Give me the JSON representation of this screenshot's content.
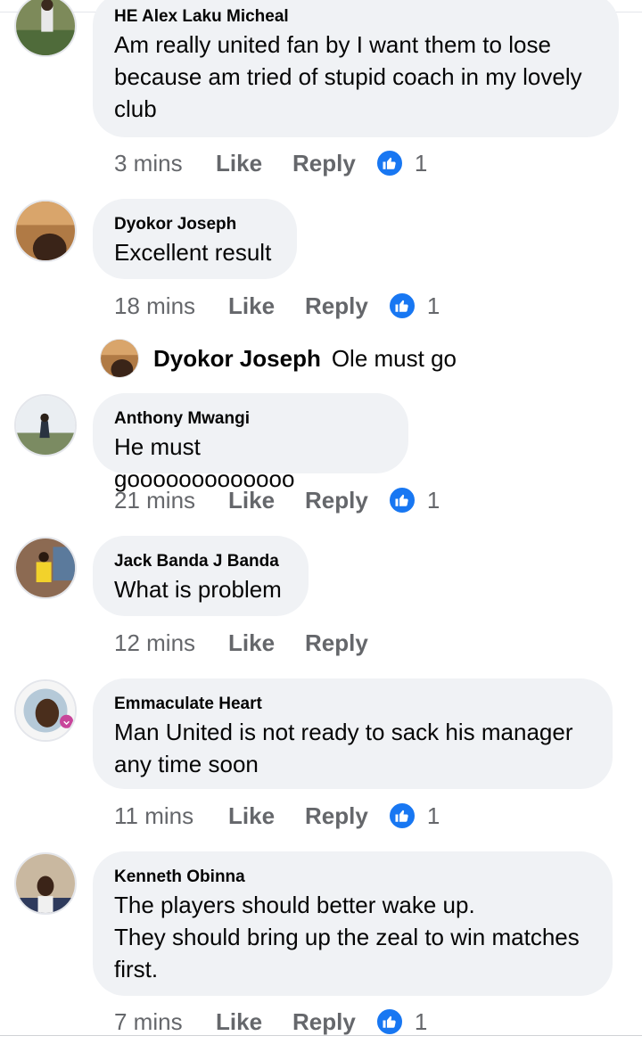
{
  "comments": [
    {
      "author": "HE Alex Laku Micheal",
      "text": "Am really united fan by I want them to lose\nbecause am tried of stupid coach in my lovely\nclub",
      "time": "3 mins",
      "like_label": "Like",
      "reply_label": "Reply",
      "reactions": "1"
    },
    {
      "author": "Dyokor Joseph",
      "text": "Excellent result",
      "time": "18 mins",
      "like_label": "Like",
      "reply_label": "Reply",
      "reactions": "1"
    },
    {
      "author": "Anthony Mwangi",
      "text": "He must gooooooooooooo",
      "time": "21 mins",
      "like_label": "Like",
      "reply_label": "Reply",
      "reactions": "1"
    },
    {
      "author": "Jack Banda J Banda",
      "text": "What is problem",
      "time": "12 mins",
      "like_label": "Like",
      "reply_label": "Reply",
      "reactions": ""
    },
    {
      "author": "Emmaculate Heart",
      "text": " Man United is not ready to sack his manager\nany time soon",
      "time": "11 mins",
      "like_label": "Like",
      "reply_label": "Reply",
      "reactions": "1"
    },
    {
      "author": "Kenneth Obinna",
      "text": "The players should better wake up.\nThey should bring up the zeal to win matches\nfirst.",
      "time": "7 mins",
      "like_label": "Like",
      "reply_label": "Reply",
      "reactions": "1"
    }
  ],
  "reply_preview": {
    "author": "Dyokor Joseph",
    "text": "Ole must go"
  },
  "colors": {
    "bubble": "#f0f2f5",
    "meta_text": "#65676b",
    "like_blue": "#1877f2"
  },
  "icons": {
    "reaction": "thumbs-up-icon"
  }
}
